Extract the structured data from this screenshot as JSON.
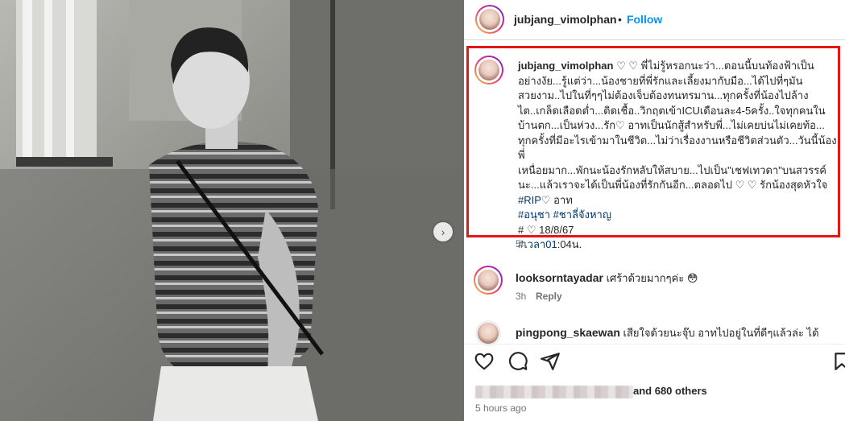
{
  "post": {
    "author": "jubjang_vimolphan",
    "separator": "•",
    "follow_label": "Follow",
    "caption_lines": [
      "♡ ♡ พี่ไม่รู้หรอกนะว่า...ตอนนี้บนท้องฟ้าเป็น",
      "อย่างงัย...รู้แต่ว่า...น้องชายที่พี่รักและเลี้ยงมากับมือ...ได้ไปที่ๆมัน",
      "สวยงาม..ไปในที่ๆๆไม่ต้องเจ็บต้องทนทรมาน...ทุกครั้งที่น้องไปล้าง",
      "ไต..เกล็ดเลือดต่ำ...ติดเชื้อ..วิกฤตเข้าICUเดือนละ4-5ครั้ง..ใจทุกคนใน",
      "บ้านตก...เป็นห่วง...รัก♡ อาทเป็นนักสู้สำหรับพี่...ไม่เคยบ่นไม่เคยท้อ...",
      "ทุกครั้งที่มีอะไรเข้ามาในชีวิต...ไม่ว่าเรื่องงานหรือชีวิตส่วนตัว...วันนี้น้องพี่",
      "เหนื่อยมาก...พักนะน้องรักหลับให้สบาย...ไปเป็น\"เชฟเทวดา\"บนสวรรค์",
      "นะ...แล้วเราจะได้เป็นพี่น้องที่รักกันอีก...ตลอดไป ♡ ♡ รักน้องสุดหัวใจ"
    ],
    "hashtag_rip": "#RIP",
    "rip_suffix": "♡ อาท",
    "hashtag_names": "#อนุชา #ชาลี่จังหาญ",
    "date_line": "# ♡ 18/8/67",
    "time_tag": "#เวลา01",
    "time_suffix": ":04น.",
    "caption_age": "5h"
  },
  "comments": [
    {
      "user": "looksorntayadar",
      "text": "เศร้าด้วยมากๆค่ะ 😳",
      "age": "3h",
      "reply_label": "Reply"
    },
    {
      "user": "pingpong_skaewan",
      "text": "เสียใจด้วยนะจุ๊บ อาทไปอยู่ในที่ดีๆแล้วล่ะ ได้"
    }
  ],
  "actions": {
    "icons": [
      "heart-icon",
      "comment-icon",
      "share-icon",
      "bookmark-icon"
    ]
  },
  "likes": {
    "text": "and 680 others",
    "time_ago": "5 hours ago"
  },
  "colors": {
    "follow": "#0095f6",
    "highlight_box": "#e01818",
    "hashtag": "#00376b"
  }
}
